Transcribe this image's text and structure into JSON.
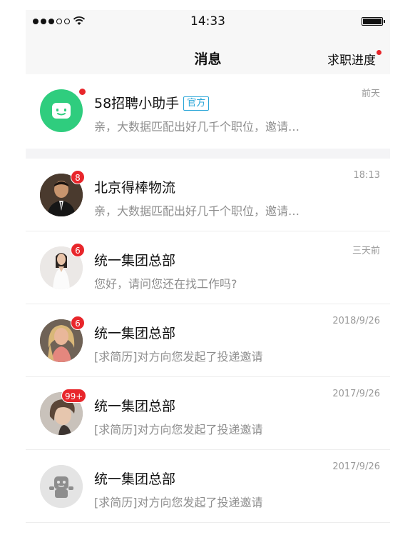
{
  "status_bar": {
    "time": "14:33",
    "signal_icon": "cellular-signal-icon",
    "wifi_icon": "wifi-icon",
    "battery_icon": "battery-icon",
    "battery_level": 1.0
  },
  "nav": {
    "title": "消息",
    "action_label": "求职进度"
  },
  "colors": {
    "badge_red": "#e8262b",
    "assistant_green": "#2fcd7e",
    "official_tag_blue": "#2aa6d8",
    "preview_gray": "#8e8e8e"
  },
  "messages": [
    {
      "name": "58招聘小助手",
      "tag": "官方",
      "preview": "亲，大数据匹配出好几千个职位，邀请…",
      "time": "前天",
      "badge": "",
      "avatar": "assistant-robot-icon"
    },
    {
      "name": "北京得棒物流",
      "preview": "亲，大数据匹配出好几千个职位，邀请…",
      "time": "18:13",
      "badge": "8",
      "avatar": "man-in-suit-photo"
    },
    {
      "name": "统一集团总部",
      "preview": "您好，请问您还在找工作吗?",
      "time": "三天前",
      "badge": "6",
      "avatar": "woman-white-dress-photo"
    },
    {
      "name": "统一集团总部",
      "preview": "[求简历]对方向您发起了投递邀请",
      "time": "2018/9/26",
      "badge": "6",
      "avatar": "blonde-woman-photo"
    },
    {
      "name": "统一集团总部",
      "preview": "[求简历]对方向您发起了投递邀请",
      "time": "2017/9/26",
      "badge": "99+",
      "avatar": "short-hair-woman-photo"
    },
    {
      "name": "统一集团总部",
      "preview": "[求简历]对方向您发起了投递邀请",
      "time": "2017/9/26",
      "badge": "",
      "avatar": "default-robot-avatar-icon"
    }
  ]
}
